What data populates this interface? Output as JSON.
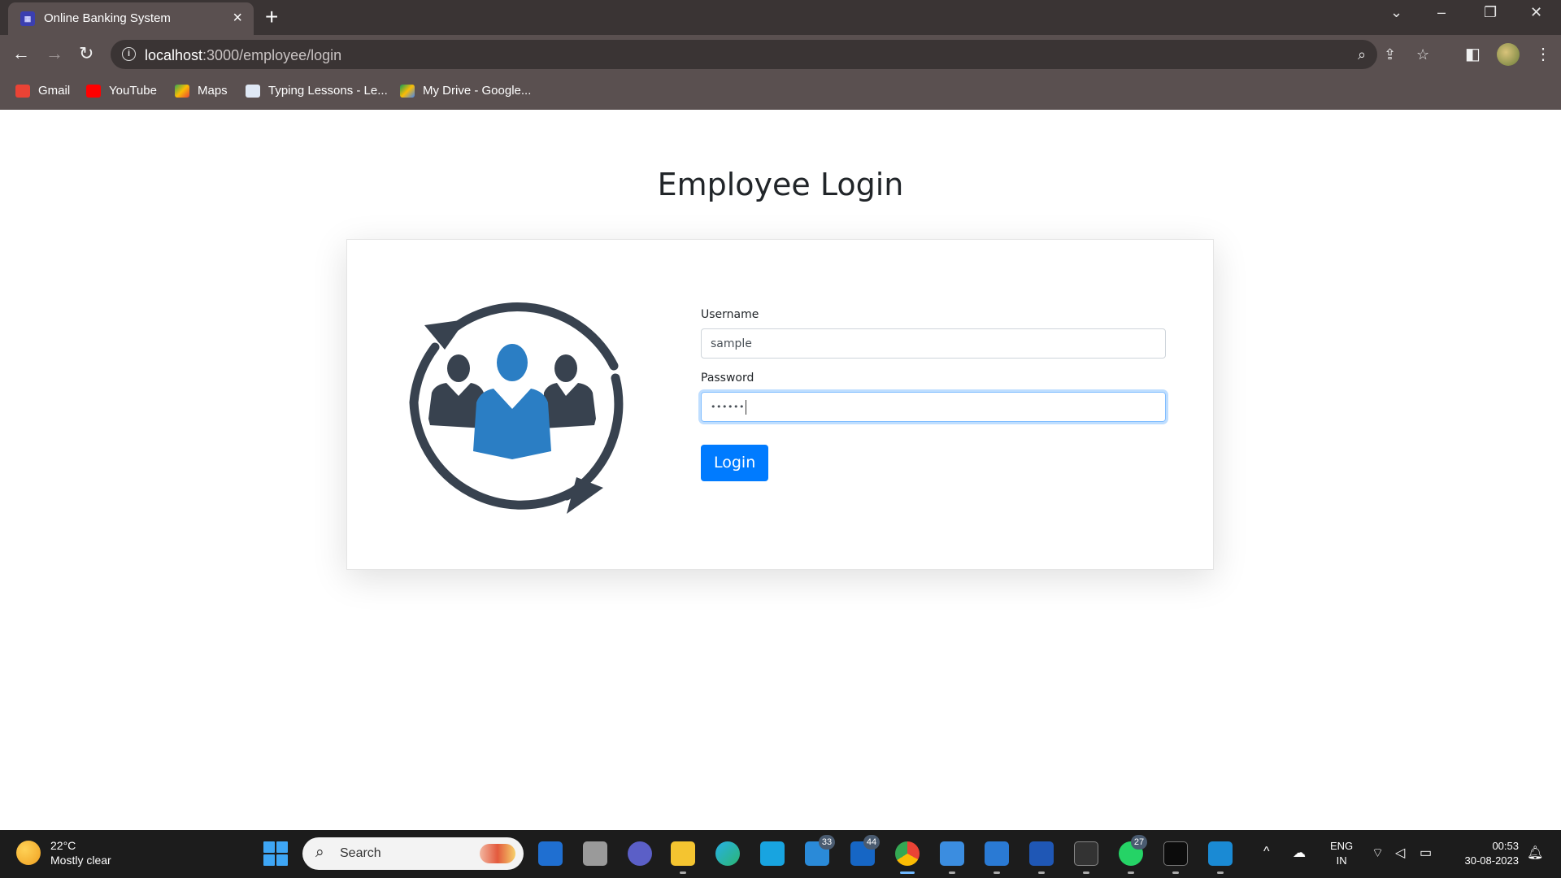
{
  "browser": {
    "tab_title": "Online Banking System",
    "tab_favicon": "bank-favicon",
    "url_host": "localhost",
    "url_path": ":3000/employee/login",
    "bookmarks": [
      {
        "label": "Gmail",
        "icon": "gmail-icon",
        "color": "#ea4335"
      },
      {
        "label": "YouTube",
        "icon": "youtube-icon",
        "color": "#ff0000"
      },
      {
        "label": "Maps",
        "icon": "maps-icon",
        "color": "#34a853"
      },
      {
        "label": "Typing Lessons - Le...",
        "icon": "typing-icon",
        "color": "#dfe8f5"
      },
      {
        "label": "My Drive - Google...",
        "icon": "drive-icon",
        "color": "#fbbc04"
      }
    ]
  },
  "page": {
    "heading": "Employee Login",
    "username_label": "Username",
    "username_value": "sample",
    "password_label": "Password",
    "password_value": "••••••",
    "login_button": "Login",
    "illustration": "team-cycle-icon",
    "colors": {
      "primary": "#007bff",
      "illustration_dark": "#38424f",
      "illustration_accent": "#2b7ec4"
    }
  },
  "taskbar": {
    "weather_temp": "22°C",
    "weather_desc": "Mostly clear",
    "search_placeholder": "Search",
    "badges": {
      "mail": "33",
      "outlook": "44",
      "whatsapp": "27"
    },
    "lang_top": "ENG",
    "lang_bottom": "IN",
    "time": "00:53",
    "date": "30-08-2023"
  }
}
